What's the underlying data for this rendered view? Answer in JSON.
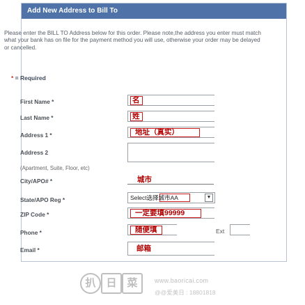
{
  "panel": {
    "title": "Add New Address to Bill To",
    "intro": "Please enter the BILL TO Address below for this order. Please note,the address you enter must match what your bank has on file for the payment method you will use, otherwise your order may be delayed or cancelled."
  },
  "required_note": {
    "star": "* ",
    "text": "= Required"
  },
  "fields": {
    "first_name": {
      "label": "First Name *",
      "value": "名"
    },
    "last_name": {
      "label": "Last Name *",
      "value": "姓"
    },
    "address1": {
      "label": "Address 1 *",
      "value": "地址（真实）"
    },
    "address2": {
      "label": "Address 2",
      "hint": "(Apartment, Suite, Floor, etc)"
    },
    "city": {
      "label": "City/APO# *",
      "value": "城市"
    },
    "state": {
      "label": "State/APO Reg *",
      "value": "Select选择城市AA",
      "arrow": "▼"
    },
    "zip": {
      "label": "ZIP Code *",
      "value": "一定要填99999"
    },
    "phone": {
      "label": "Phone *",
      "value": "随便填",
      "ext_label": "Ext"
    },
    "email": {
      "label": "Email *",
      "value": "邮箱"
    }
  },
  "watermark": {
    "logo_chars": [
      "扒",
      "日",
      "菜"
    ],
    "url": "www.baoricai.com",
    "sub": "@@爱美日  :  18801818"
  },
  "colors": {
    "header": "#4f73a8",
    "annotation": "#cc1b1b"
  }
}
